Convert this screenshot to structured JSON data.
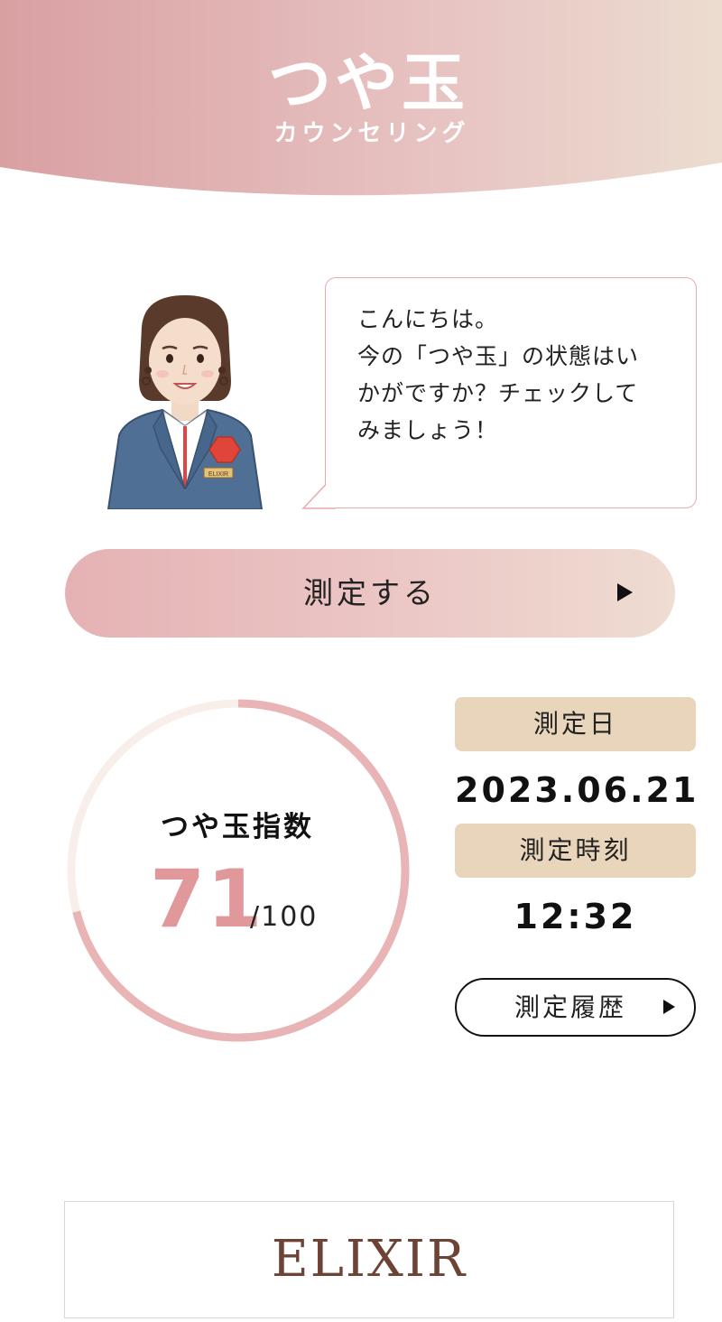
{
  "header": {
    "title": "つや玉",
    "subtitle": "カウンセリング",
    "gradient_colors": [
      "#d9a0a2",
      "#e7c3c2",
      "#ecdcd0"
    ]
  },
  "avatar": {
    "icon": "counselor-avatar-icon",
    "badge_text": "ELIXIR"
  },
  "speech_bubble": {
    "text": "こんにちは。\n今の「つや玉」の状態はい\nかがですか？チェックして\nみましょう！"
  },
  "measure_button": {
    "label": "測定する",
    "icon": "play-arrow-icon"
  },
  "gauge": {
    "label": "つや玉指数",
    "score": "71",
    "max_label": "/100",
    "progress_fraction": 0.71,
    "fill_color": "#e8b4b5",
    "track_color": "#f8efea"
  },
  "measurement": {
    "date_label": "測定日",
    "date_value": "2023.06.21",
    "time_label": "測定時刻",
    "time_value": "12:32"
  },
  "history_button": {
    "label": "測定履歴",
    "icon": "play-arrow-icon"
  },
  "footer": {
    "logo_text": "ELIXIR",
    "logo_color": "#6d4335"
  },
  "colors": {
    "accent_pink": "#e0989a",
    "beige_pill": "#e8d5bc"
  }
}
